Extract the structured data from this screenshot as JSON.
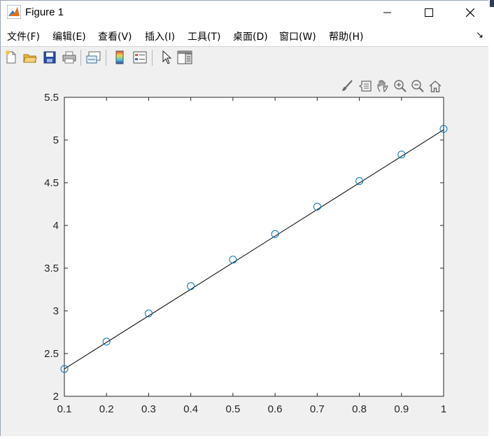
{
  "window": {
    "title": "Figure 1",
    "controls": {
      "minimize": "minimize",
      "maximize": "maximize",
      "close": "close"
    }
  },
  "menubar": {
    "items": [
      {
        "label": "文件(F)"
      },
      {
        "label": "编辑(E)"
      },
      {
        "label": "查看(V)"
      },
      {
        "label": "插入(I)"
      },
      {
        "label": "工具(T)"
      },
      {
        "label": "桌面(D)"
      },
      {
        "label": "窗口(W)"
      },
      {
        "label": "帮助(H)"
      }
    ],
    "dock_icon": "dock-arrow-icon"
  },
  "toolbar": {
    "buttons": [
      "new-figure-icon",
      "open-file-icon",
      "save-icon",
      "print-icon",
      "link-plot-icon",
      "insert-colorbar-icon",
      "insert-legend-icon",
      "edit-plot-icon",
      "property-inspector-icon"
    ]
  },
  "axes_toolbar": {
    "buttons": [
      "brush-icon",
      "data-tips-icon",
      "pan-icon",
      "zoom-in-icon",
      "zoom-out-icon",
      "home-icon"
    ]
  },
  "colors": {
    "marker": "#0072bd",
    "line": "#000000",
    "axes_bg": "#ffffff",
    "figure_bg": "#f0f0f0"
  },
  "chart_data": {
    "type": "scatter",
    "title": "",
    "xlabel": "",
    "ylabel": "",
    "xlim": [
      0.1,
      1
    ],
    "ylim": [
      2,
      5.5
    ],
    "xticks": [
      "0.1",
      "0.2",
      "0.3",
      "0.4",
      "0.5",
      "0.6",
      "0.7",
      "0.8",
      "0.9",
      "1"
    ],
    "yticks": [
      "2",
      "2.5",
      "3",
      "3.5",
      "4",
      "4.5",
      "5",
      "5.5"
    ],
    "grid": false,
    "series": [
      {
        "style": "markers",
        "marker": "circle",
        "x": [
          0.1,
          0.2,
          0.3,
          0.4,
          0.5,
          0.6,
          0.7,
          0.8,
          0.9,
          1.0
        ],
        "y": [
          2.32,
          2.64,
          2.97,
          3.29,
          3.6,
          3.9,
          4.22,
          4.52,
          4.83,
          5.13
        ]
      },
      {
        "style": "line",
        "x": [
          0.1,
          1.0
        ],
        "y": [
          2.32,
          5.12
        ]
      }
    ]
  }
}
